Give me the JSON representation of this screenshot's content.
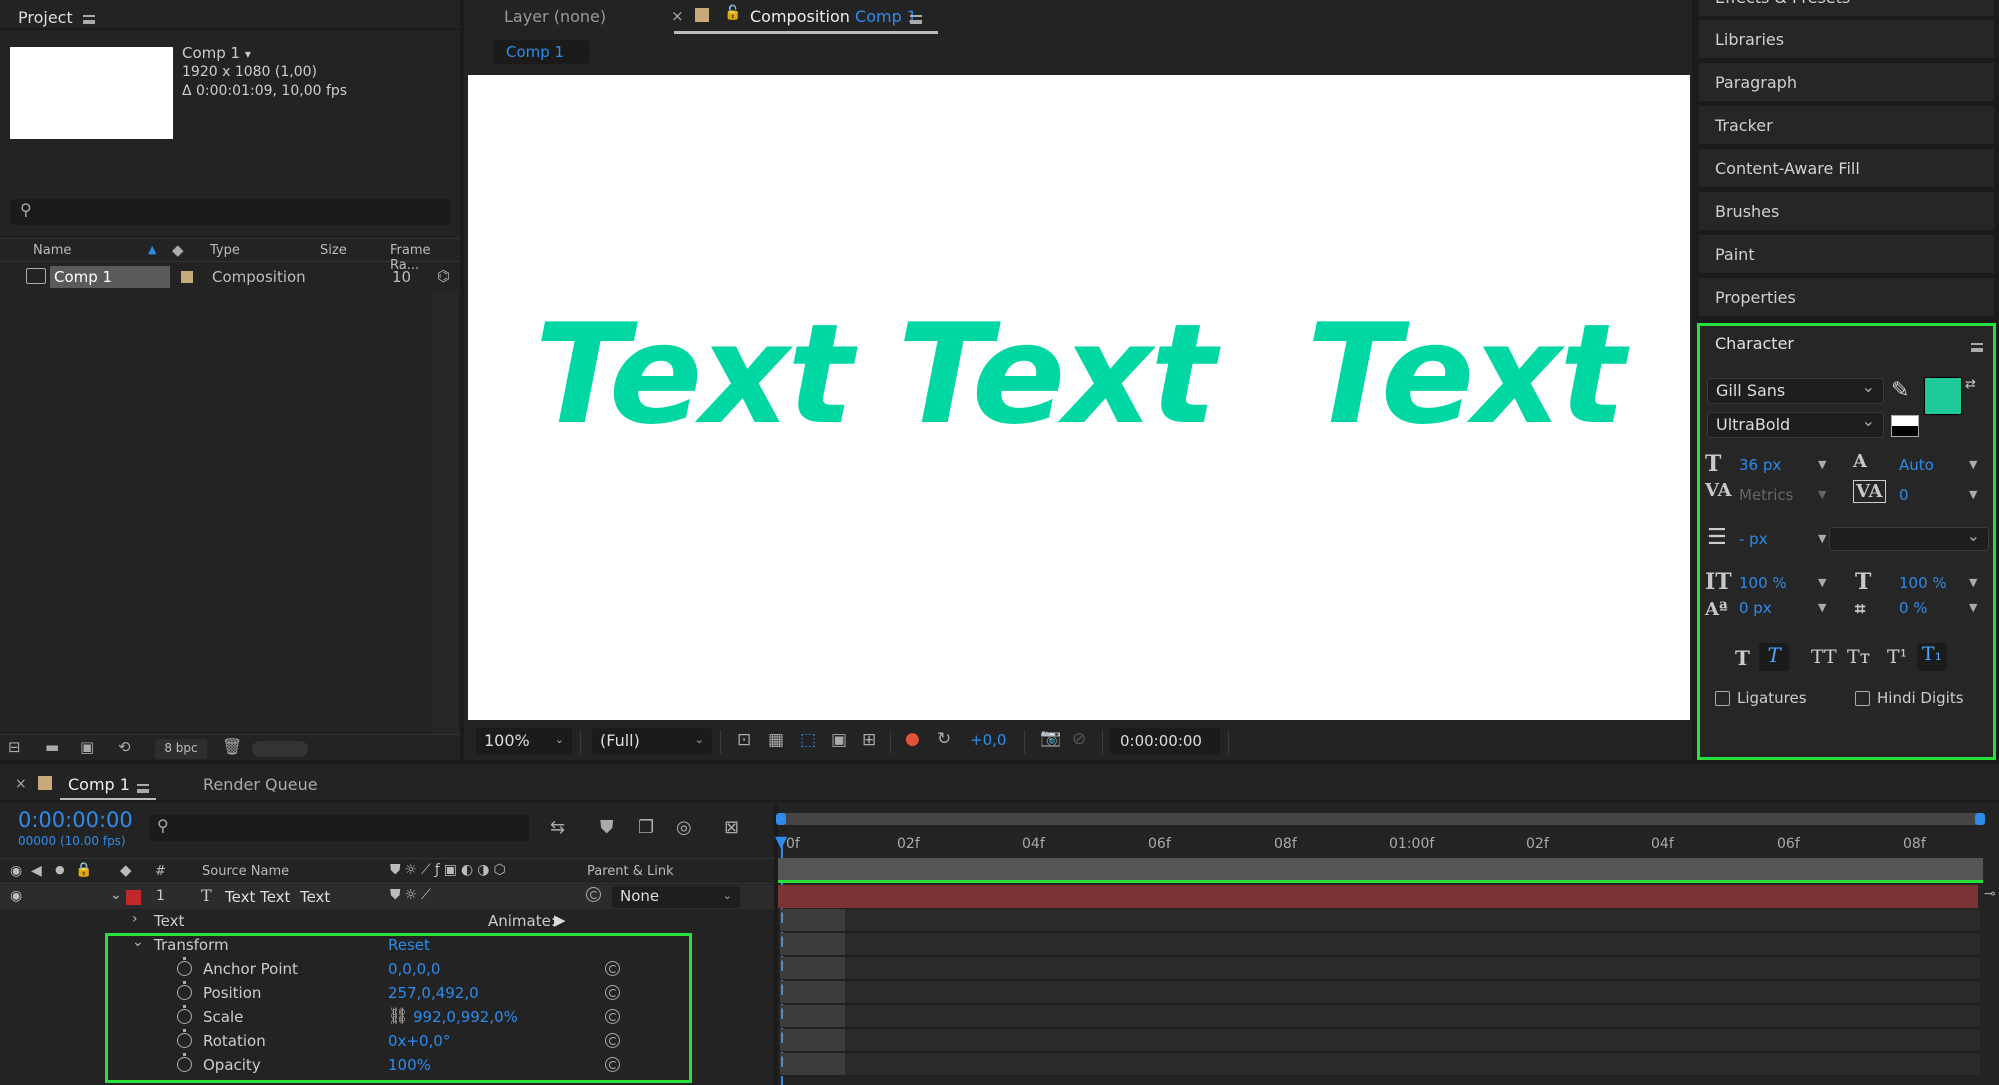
{
  "project": {
    "title": "Project",
    "comp_name": "Comp 1",
    "comp_caret": "▾",
    "comp_resolution": "1920 x 1080 (1,00)",
    "comp_duration": "Δ 0:00:01:09, 10,00 fps",
    "columns": {
      "name": "Name",
      "type": "Type",
      "size": "Size",
      "frame_rate": "Frame Ra..."
    },
    "rows": [
      {
        "name": "Comp 1",
        "type": "Composition",
        "frame_rate": "10"
      }
    ],
    "bpc": "8 bpc"
  },
  "viewer": {
    "layer_tab": "Layer (none)",
    "comp_tab_prefix": "Composition",
    "comp_tab_name": "Comp 1",
    "breadcrumb": "Comp 1",
    "canvas_text": "Text Text  Text",
    "text_color": "#00d7a3",
    "zoom": "100%",
    "resolution": "(Full)",
    "exposure": "+0,0",
    "timecode": "0:00:00:00"
  },
  "sidebar": {
    "items": [
      "Effects & Presets",
      "Libraries",
      "Paragraph",
      "Tracker",
      "Content-Aware Fill",
      "Brushes",
      "Paint",
      "Properties"
    ]
  },
  "character": {
    "title": "Character",
    "font_family": "Gill Sans",
    "font_style": "UltraBold",
    "fill_color": "#1ec99a",
    "font_size": "36 px",
    "leading": "Auto",
    "kerning": "Metrics",
    "tracking": "0",
    "stroke_width": "- px",
    "vertical_scale": "100 %",
    "horizontal_scale": "100 %",
    "baseline_shift": "0 px",
    "tsume": "0 %",
    "ligatures": "Ligatures",
    "hindi_digits": "Hindi Digits"
  },
  "timeline": {
    "comp_tab": "Comp 1",
    "render_queue_tab": "Render Queue",
    "timecode": "0:00:00:00",
    "frame_info": "00000 (10.00 fps)",
    "columns": {
      "num": "#",
      "source_name": "Source Name",
      "parent_link": "Parent & Link"
    },
    "layer": {
      "index": "1",
      "type_glyph": "T",
      "name": "Text Text  Text",
      "parent": "None",
      "color": "#c0282a"
    },
    "text_group": "Text",
    "animate_label": "Animate:",
    "transform": {
      "label": "Transform",
      "reset": "Reset",
      "props": [
        {
          "name": "Anchor Point",
          "value": "0,0,0,0"
        },
        {
          "name": "Position",
          "value": "257,0,492,0"
        },
        {
          "name": "Scale",
          "value": "992,0,992,0%"
        },
        {
          "name": "Rotation",
          "value": "0x+0,0°"
        },
        {
          "name": "Opacity",
          "value": "100%"
        }
      ]
    },
    "ruler": [
      "0f",
      "02f",
      "04f",
      "06f",
      "08f",
      "01:00f",
      "02f",
      "04f",
      "06f",
      "08f"
    ]
  }
}
